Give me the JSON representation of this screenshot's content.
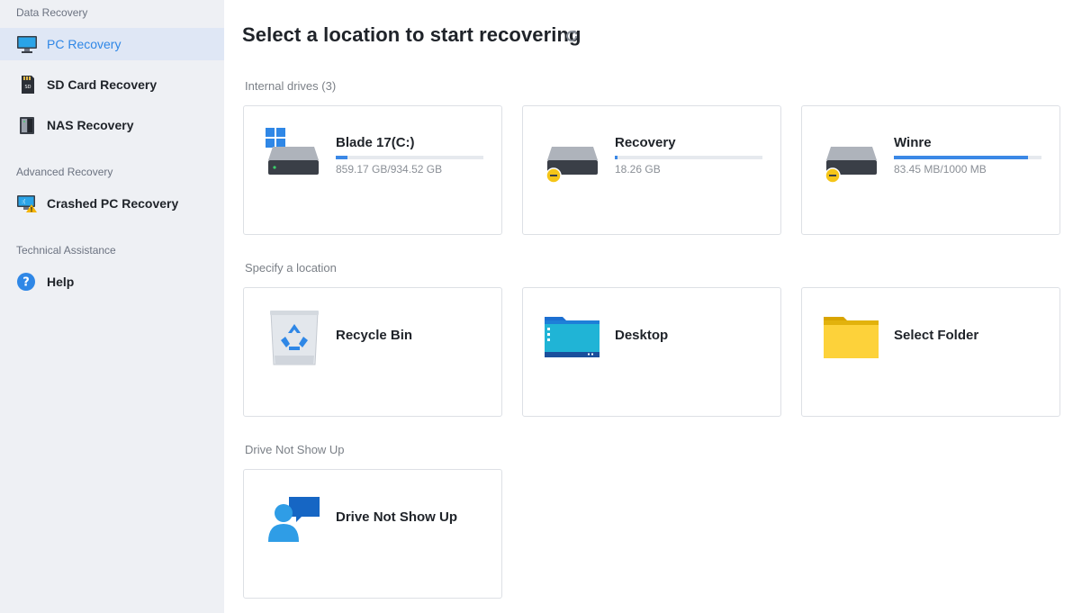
{
  "sidebar": {
    "sections": {
      "data_recovery": "Data Recovery",
      "advanced_recovery": "Advanced Recovery",
      "technical_assistance": "Technical Assistance"
    },
    "items": {
      "pc_recovery": {
        "label": "PC Recovery",
        "icon": "monitor-icon",
        "active": true
      },
      "sd_card_recovery": {
        "label": "SD Card Recovery",
        "icon": "sd-card-icon"
      },
      "nas_recovery": {
        "label": "NAS Recovery",
        "icon": "nas-icon"
      },
      "crashed_pc_recovery": {
        "label": "Crashed PC Recovery",
        "icon": "crashed-pc-icon"
      },
      "help": {
        "label": "Help",
        "icon": "help-icon"
      }
    }
  },
  "main": {
    "title": "Select a location to start recovering",
    "internal_drives_label": "Internal drives (3)",
    "drives": [
      {
        "name": "Blade 17(C:)",
        "size": "859.17 GB/934.52 GB",
        "usage": 0.08,
        "icon": "windows-drive-icon"
      },
      {
        "name": "Recovery",
        "size": "18.26 GB",
        "usage": 0.02,
        "icon": "drive-minus-icon"
      },
      {
        "name": "Winre",
        "size": "83.45 MB/1000 MB",
        "usage": 0.91,
        "icon": "drive-minus-icon"
      }
    ],
    "specify_location_label": "Specify a location",
    "locations": [
      {
        "name": "Recycle Bin",
        "icon": "recycle-bin-icon"
      },
      {
        "name": "Desktop",
        "icon": "desktop-folder-icon"
      },
      {
        "name": "Select Folder",
        "icon": "folder-icon"
      }
    ],
    "drive_not_show_label": "Drive Not Show Up",
    "drive_not_show_card": {
      "name": "Drive Not Show Up",
      "icon": "support-chat-icon"
    }
  },
  "colors": {
    "accent": "#2f87e6",
    "sidebar_bg": "#eef0f4",
    "active_bg": "#dfe7f5",
    "bar_fill": "#3b88e6"
  }
}
